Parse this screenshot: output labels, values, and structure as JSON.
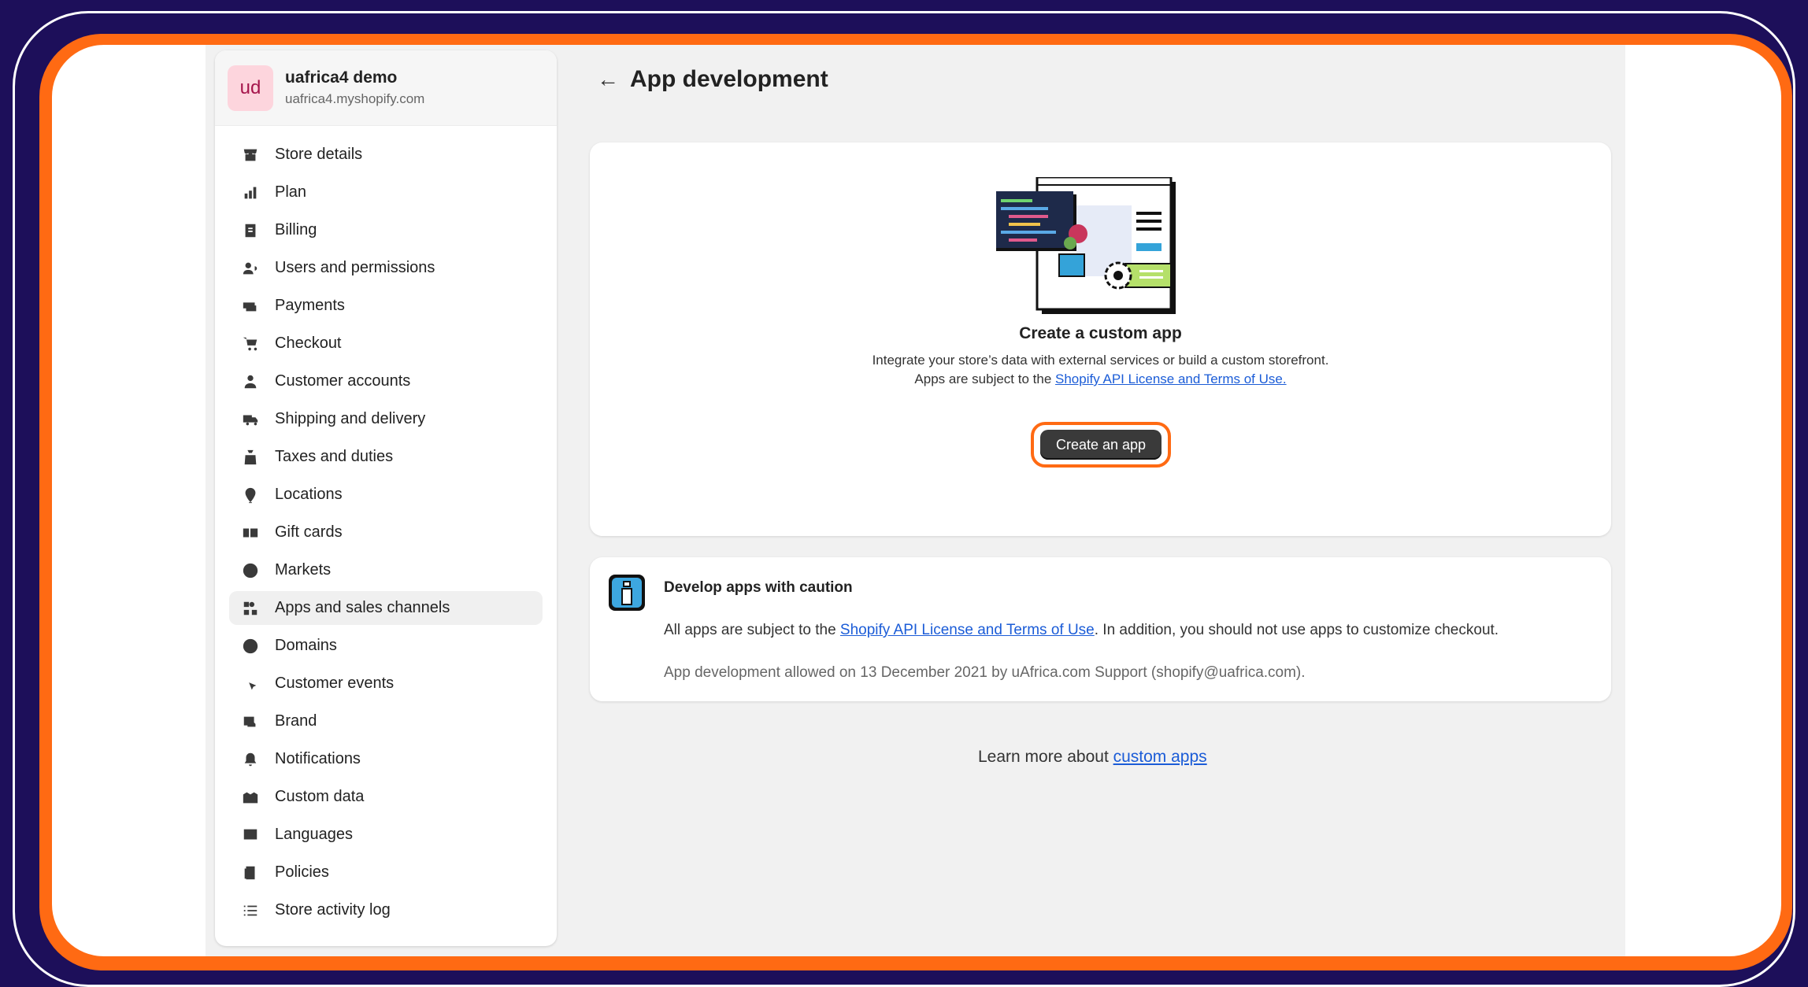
{
  "store": {
    "initials": "ud",
    "name": "uafrica4 demo",
    "domain": "uafrica4.myshopify.com"
  },
  "sidebar": {
    "items": [
      {
        "label": "Store details",
        "icon": "store-icon"
      },
      {
        "label": "Plan",
        "icon": "plan-icon"
      },
      {
        "label": "Billing",
        "icon": "billing-icon"
      },
      {
        "label": "Users and permissions",
        "icon": "users-icon"
      },
      {
        "label": "Payments",
        "icon": "payments-icon"
      },
      {
        "label": "Checkout",
        "icon": "cart-icon"
      },
      {
        "label": "Customer accounts",
        "icon": "person-icon"
      },
      {
        "label": "Shipping and delivery",
        "icon": "truck-icon"
      },
      {
        "label": "Taxes and duties",
        "icon": "taxes-icon"
      },
      {
        "label": "Locations",
        "icon": "location-icon"
      },
      {
        "label": "Gift cards",
        "icon": "gift-card-icon"
      },
      {
        "label": "Markets",
        "icon": "globe-currency-icon"
      },
      {
        "label": "Apps and sales channels",
        "icon": "apps-icon",
        "active": true
      },
      {
        "label": "Domains",
        "icon": "globe-icon"
      },
      {
        "label": "Customer events",
        "icon": "cursor-click-icon"
      },
      {
        "label": "Brand",
        "icon": "brand-icon"
      },
      {
        "label": "Notifications",
        "icon": "bell-icon"
      },
      {
        "label": "Custom data",
        "icon": "custom-data-icon"
      },
      {
        "label": "Languages",
        "icon": "language-icon"
      },
      {
        "label": "Policies",
        "icon": "policies-icon"
      },
      {
        "label": "Store activity log",
        "icon": "list-icon"
      }
    ]
  },
  "page": {
    "back_arrow": "←",
    "title": "App development"
  },
  "hero": {
    "title": "Create a custom app",
    "desc_pre": "Integrate your store’s data with external services or build a custom storefront. Apps are subject to the ",
    "desc_link": "Shopify API License and Terms of Use.",
    "button_label": "Create an app"
  },
  "caution": {
    "title": "Develop apps with caution",
    "body_pre": "All apps are subject to the ",
    "body_link": "Shopify API License and Terms of Use",
    "body_post": ". In addition, you should not use apps to customize checkout.",
    "meta": "App development allowed on 13 December 2021 by uAfrica.com Support (shopify@uafrica.com)."
  },
  "footer": {
    "learn_pre": "Learn more about ",
    "learn_link": "custom apps"
  },
  "colors": {
    "background": "#1d0f5a",
    "frame_accent": "#ff6a13",
    "link": "#1b5cd7",
    "primary_button": "#3a3a3a"
  }
}
